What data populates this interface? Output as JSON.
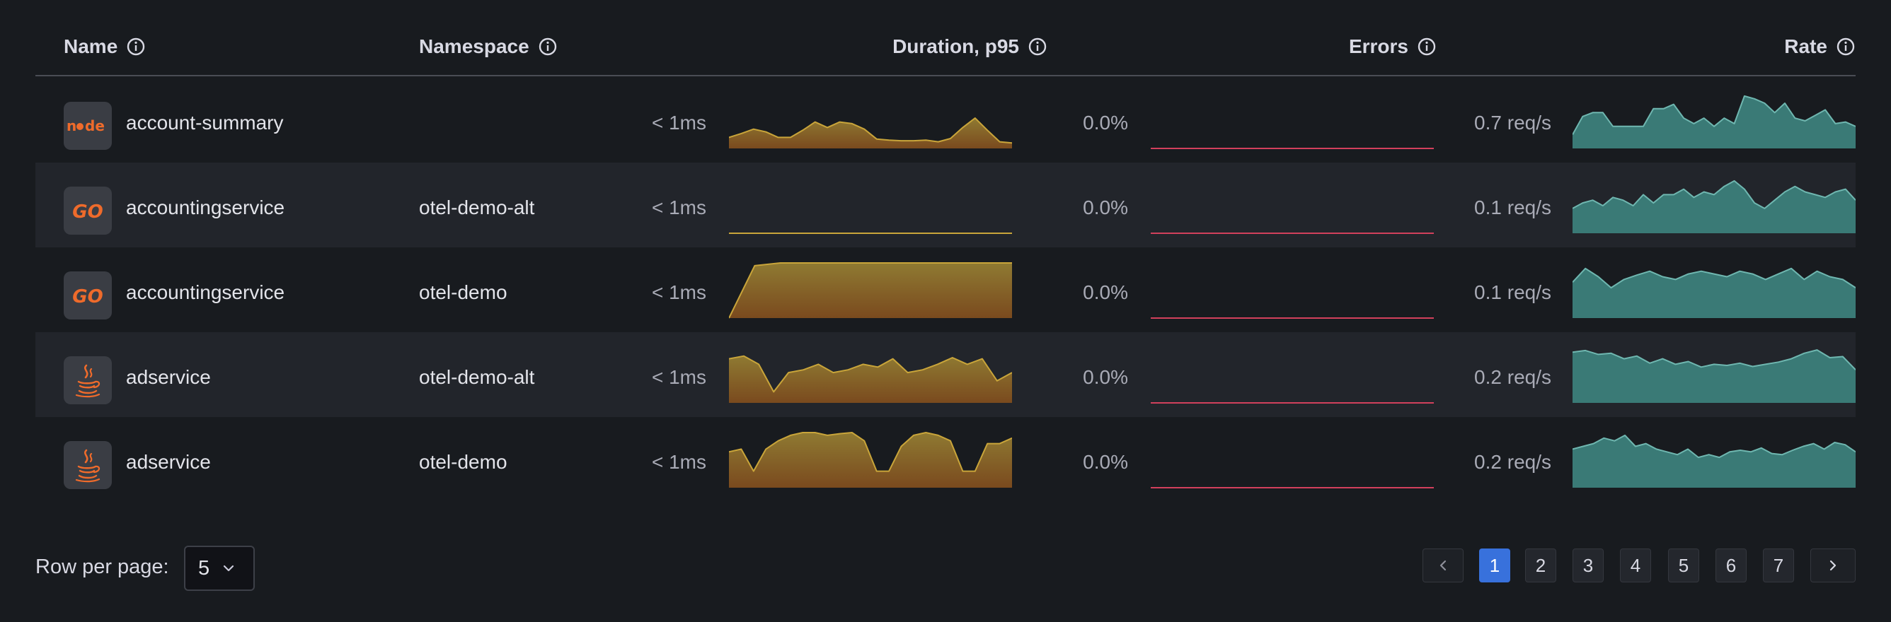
{
  "table": {
    "columns": [
      {
        "key": "name",
        "label": "Name"
      },
      {
        "key": "namespace",
        "label": "Namespace"
      },
      {
        "key": "duration",
        "label": "Duration, p95"
      },
      {
        "key": "errors",
        "label": "Errors"
      },
      {
        "key": "rate",
        "label": "Rate"
      }
    ],
    "info_icon": "info-circle-icon",
    "rows": [
      {
        "name": "account-summary",
        "namespace": "",
        "logo": "nodejs-logo",
        "duration": "< 1ms",
        "errors": "0.0%",
        "rate": "0.7 req/s",
        "duration_series": [
          0.2,
          0.27,
          0.35,
          0.3,
          0.2,
          0.2,
          0.33,
          0.48,
          0.38,
          0.48,
          0.45,
          0.35,
          0.17,
          0.15,
          0.14,
          0.14,
          0.15,
          0.12,
          0.18,
          0.38,
          0.55,
          0.33,
          0.12,
          0.1
        ],
        "errors_series": [
          0,
          0,
          0,
          0,
          0,
          0,
          0,
          0,
          0,
          0,
          0,
          0
        ],
        "rate_series": [
          0.25,
          0.58,
          0.65,
          0.65,
          0.4,
          0.4,
          0.4,
          0.4,
          0.72,
          0.72,
          0.8,
          0.55,
          0.45,
          0.55,
          0.4,
          0.55,
          0.45,
          0.95,
          0.9,
          0.82,
          0.65,
          0.82,
          0.55,
          0.5,
          0.6,
          0.7,
          0.45,
          0.48,
          0.4
        ]
      },
      {
        "name": "accountingservice",
        "namespace": "otel-demo-alt",
        "logo": "go-logo",
        "duration": "< 1ms",
        "errors": "0.0%",
        "rate": "0.1 req/s",
        "duration_series": [
          0,
          0,
          0,
          0,
          0,
          0,
          0,
          0,
          0,
          0,
          0,
          0
        ],
        "errors_series": [
          0,
          0,
          0,
          0,
          0,
          0,
          0,
          0,
          0,
          0,
          0,
          0
        ],
        "rate_series": [
          0.45,
          0.55,
          0.6,
          0.5,
          0.65,
          0.6,
          0.5,
          0.7,
          0.55,
          0.7,
          0.7,
          0.8,
          0.65,
          0.75,
          0.7,
          0.85,
          0.95,
          0.8,
          0.55,
          0.45,
          0.6,
          0.75,
          0.85,
          0.75,
          0.7,
          0.65,
          0.75,
          0.8,
          0.6
        ]
      },
      {
        "name": "accountingservice",
        "namespace": "otel-demo",
        "logo": "go-logo",
        "duration": "< 1ms",
        "errors": "0.0%",
        "rate": "0.1 req/s",
        "duration_series": [
          0,
          0.95,
          1,
          1,
          1,
          1,
          1,
          1,
          1,
          1,
          1,
          1
        ],
        "errors_series": [
          0,
          0,
          0,
          0,
          0,
          0,
          0,
          0,
          0,
          0,
          0,
          0
        ],
        "rate_series": [
          0.65,
          0.9,
          0.75,
          0.55,
          0.7,
          0.78,
          0.85,
          0.75,
          0.7,
          0.8,
          0.85,
          0.8,
          0.75,
          0.85,
          0.8,
          0.7,
          0.8,
          0.9,
          0.7,
          0.85,
          0.75,
          0.7,
          0.55
        ]
      },
      {
        "name": "adservice",
        "namespace": "otel-demo-alt",
        "logo": "java-logo",
        "duration": "< 1ms",
        "errors": "0.0%",
        "rate": "0.2 req/s",
        "duration_series": [
          0.8,
          0.85,
          0.7,
          0.2,
          0.55,
          0.6,
          0.7,
          0.55,
          0.6,
          0.7,
          0.65,
          0.8,
          0.55,
          0.6,
          0.7,
          0.82,
          0.7,
          0.8,
          0.4,
          0.55
        ],
        "errors_series": [
          0,
          0,
          0,
          0,
          0,
          0,
          0,
          0,
          0,
          0,
          0,
          0
        ],
        "rate_series": [
          0.92,
          0.95,
          0.88,
          0.9,
          0.8,
          0.85,
          0.72,
          0.8,
          0.7,
          0.75,
          0.65,
          0.7,
          0.68,
          0.72,
          0.66,
          0.7,
          0.74,
          0.8,
          0.9,
          0.96,
          0.82,
          0.84,
          0.6
        ]
      },
      {
        "name": "adservice",
        "namespace": "otel-demo",
        "logo": "java-logo",
        "duration": "< 1ms",
        "errors": "0.0%",
        "rate": "0.2 req/s",
        "duration_series": [
          0.65,
          0.7,
          0.3,
          0.7,
          0.85,
          0.95,
          1,
          1,
          0.95,
          0.98,
          1,
          0.85,
          0.3,
          0.3,
          0.75,
          0.95,
          1,
          0.95,
          0.85,
          0.3,
          0.3,
          0.8,
          0.8,
          0.9
        ],
        "errors_series": [
          0,
          0,
          0,
          0,
          0,
          0,
          0,
          0,
          0,
          0,
          0,
          0
        ],
        "rate_series": [
          0.7,
          0.75,
          0.8,
          0.9,
          0.85,
          0.95,
          0.75,
          0.8,
          0.7,
          0.65,
          0.6,
          0.7,
          0.55,
          0.6,
          0.55,
          0.65,
          0.68,
          0.65,
          0.72,
          0.62,
          0.6,
          0.68,
          0.75,
          0.8,
          0.7,
          0.82,
          0.78,
          0.65
        ]
      }
    ]
  },
  "footer": {
    "rows_per_page_label": "Row per page:",
    "rows_per_page_value": "5",
    "pages": [
      "1",
      "2",
      "3",
      "4",
      "5",
      "6",
      "7"
    ],
    "current_page": "1",
    "prev_icon": "chevron-left-icon",
    "next_icon": "chevron-right-icon"
  },
  "colors": {
    "background": "#181b1f",
    "row_alt": "#22252b",
    "duration_fill_top": "#8f7a32",
    "duration_fill_bottom": "#7a4a1e",
    "duration_line": "#c9a53a",
    "errors_line": "#d2405c",
    "rate_fill": "#3a7a76",
    "rate_line": "#6fb7b0",
    "accent": "#3871dc",
    "brand_orange": "#ef6b2b"
  }
}
